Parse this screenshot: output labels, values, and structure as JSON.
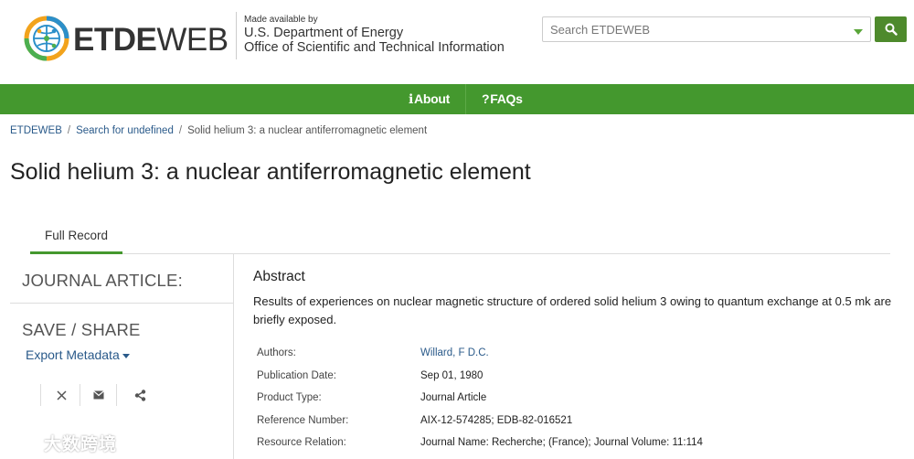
{
  "header": {
    "logo": {
      "bold": "ETDE",
      "thin": "WEB"
    },
    "made_by_small": "Made available by",
    "made_by_line1": "U.S. Department of Energy",
    "made_by_line2": "Office of Scientific and Technical Information",
    "search_placeholder": "Search ETDEWEB"
  },
  "nav": {
    "about_label": "About",
    "faqs_label": "FAQs"
  },
  "breadcrumb": {
    "home": "ETDEWEB",
    "search": "Search for undefined",
    "current": "Solid helium 3: a nuclear antiferromagnetic element"
  },
  "page_title": "Solid helium 3: a nuclear antiferromagnetic element",
  "tabs": {
    "full_record": "Full Record"
  },
  "sidebar": {
    "doc_type": "JOURNAL ARTICLE:",
    "save_share": "SAVE / SHARE",
    "export_metadata": "Export Metadata"
  },
  "abstract": {
    "heading": "Abstract",
    "text": "Results of experiences on nuclear magnetic structure of ordered solid helium 3 owing to quantum exchange at 0.5 mk are briefly exposed."
  },
  "metadata": [
    {
      "key": "Authors:",
      "value": "Willard, F D.C.",
      "link": true
    },
    {
      "key": "Publication Date:",
      "value": "Sep 01, 1980",
      "link": false
    },
    {
      "key": "Product Type:",
      "value": "Journal Article",
      "link": false
    },
    {
      "key": "Reference Number:",
      "value": "AIX-12-574285; EDB-82-016521",
      "link": false
    },
    {
      "key": "Resource Relation:",
      "value": "Journal Name: Recherche; (France); Journal Volume: 11:114",
      "link": false
    }
  ],
  "watermark": "大数跨境",
  "colors": {
    "green_bar": "#44982e",
    "search_btn": "#4e8a2c",
    "link": "#2a5a8a"
  }
}
